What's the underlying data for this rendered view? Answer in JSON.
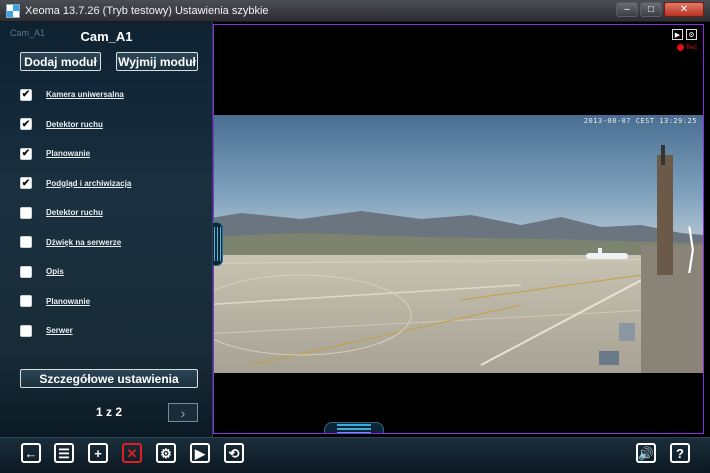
{
  "window": {
    "title": "Xeoma 13.7.26 (Tryb testowy) Ustawienia szybkie",
    "minimize": "–",
    "maximize": "□",
    "close": "✕"
  },
  "panel": {
    "ghost_label": "Cam_A1",
    "title": "Cam_A1",
    "add_module": "Dodaj moduł",
    "remove_module": "Wyjmij moduł",
    "modules": [
      {
        "label": "Kamera uniwersalna",
        "checked": true
      },
      {
        "label": "Detektor ruchu",
        "checked": true
      },
      {
        "label": "Planowanie",
        "checked": true
      },
      {
        "label": "Podgląd i archiwizacja",
        "checked": true
      },
      {
        "label": "Detektor ruchu",
        "checked": false
      },
      {
        "label": "Dźwięk na serwerze",
        "checked": false
      },
      {
        "label": "Opis",
        "checked": false
      },
      {
        "label": "Planowanie",
        "checked": false
      },
      {
        "label": "Serwer",
        "checked": false
      }
    ],
    "details_button": "Szczegółowe ustawienia",
    "pager": "1 z 2",
    "pager_next": "›"
  },
  "video": {
    "timestamp": "2013-08-07 CEST 13:29:25",
    "rec_label": "Rec",
    "play_icon": "▶",
    "settings_icon": "⚙",
    "next_arrow": "⟩"
  },
  "colors": {
    "accent": "#3ab0d8",
    "frame": "#8a2be2",
    "rec": "#e01010",
    "delete": "#e02020"
  },
  "toolbar": {
    "back": "←",
    "list": "☰",
    "add": "+",
    "delete": "✕",
    "settings": "⚙",
    "play": "▶",
    "rotate": "⟲",
    "sound": "🔊",
    "help": "?"
  }
}
